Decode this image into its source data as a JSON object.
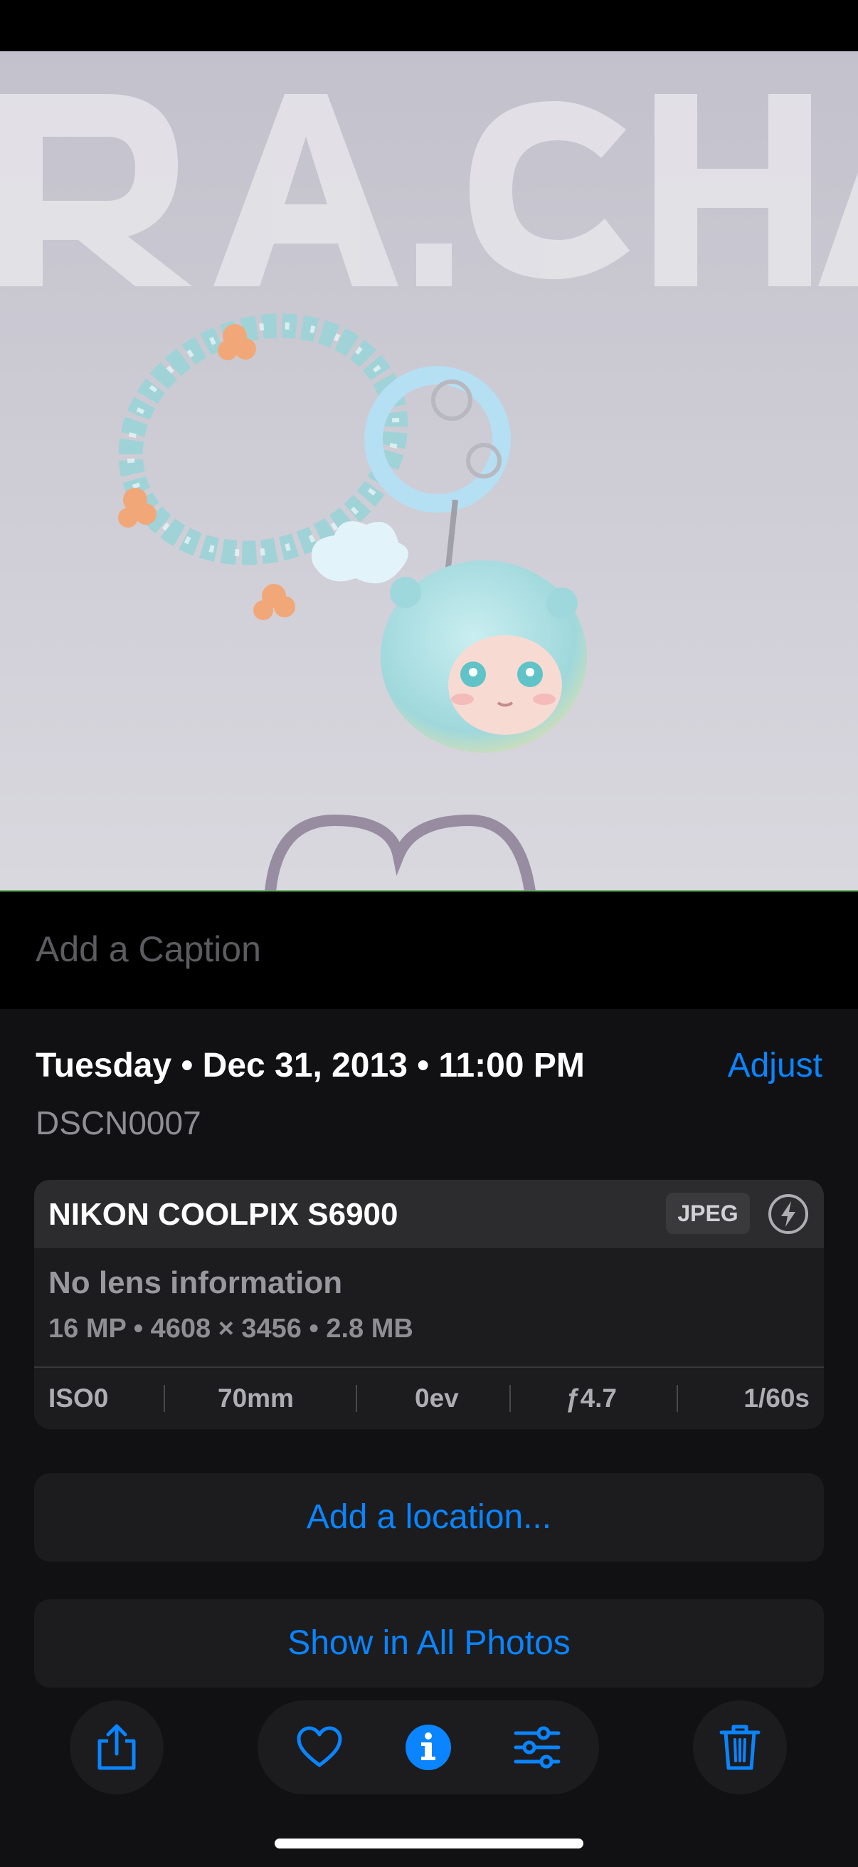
{
  "photo": {
    "subject": "beaded keychain with charm figure",
    "background_text": "RA, CHAI"
  },
  "caption": {
    "placeholder": "Add a Caption"
  },
  "info": {
    "date_text": "Tuesday • Dec 31, 2013 • 11:00 PM",
    "adjust_label": "Adjust",
    "filename": "DSCN0007"
  },
  "camera": {
    "model": "NIKON COOLPIX S6900",
    "format": "JPEG",
    "flash_icon": "flash-icon",
    "lens": "No lens information",
    "specs": "16 MP • 4608 × 3456 • 2.8 MB",
    "exif": {
      "iso": "ISO0",
      "focal_length": "70mm",
      "exposure": "0ev",
      "aperture": "ƒ4.7",
      "shutter": "1/60s"
    }
  },
  "actions": {
    "add_location": "Add a location...",
    "show_all": "Show in All Photos"
  },
  "toolbar": {
    "share_icon": "share-icon",
    "favorite_icon": "heart-icon",
    "info_icon": "info-icon",
    "edit_icon": "sliders-icon",
    "delete_icon": "trash-icon"
  },
  "colors": {
    "accent": "#0a84ff",
    "sheet_bg": "#111113",
    "card_bg": "#1c1c1e"
  }
}
